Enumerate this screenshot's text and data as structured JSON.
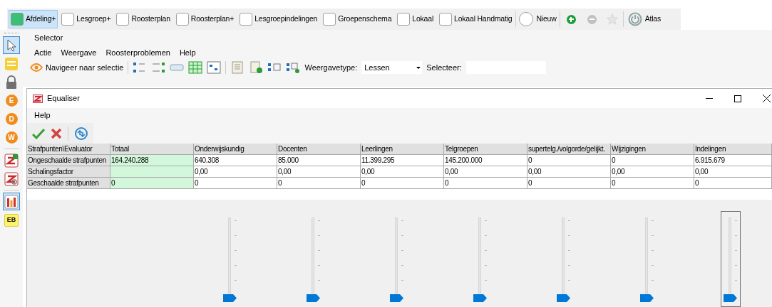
{
  "top_toolbar": [
    {
      "kind": "check",
      "label": "Afdeling+",
      "checked": true
    },
    {
      "kind": "check",
      "label": "Lesgroep+",
      "checked": false
    },
    {
      "kind": "check",
      "label": "Roosterplan",
      "checked": false
    },
    {
      "kind": "check",
      "label": "Roosterplan+",
      "checked": false
    },
    {
      "kind": "check",
      "label": "Lesgroepindelingen",
      "checked": false
    },
    {
      "kind": "check",
      "label": "Groepenschema",
      "checked": false
    },
    {
      "kind": "check",
      "label": "Lokaal",
      "checked": false
    },
    {
      "kind": "check",
      "label": "Lokaal Handmatig",
      "checked": false
    },
    {
      "kind": "radio",
      "label": "Nieuw",
      "checked": false
    },
    {
      "kind": "add",
      "disabled": false
    },
    {
      "kind": "remove",
      "disabled": true
    },
    {
      "kind": "star",
      "disabled": true
    },
    {
      "kind": "power",
      "label": "Atlas",
      "disabled": false
    }
  ],
  "sidebar": [
    {
      "kind": "pointer",
      "selected": true
    },
    {
      "kind": "note",
      "selected": false
    },
    {
      "kind": "lock",
      "selected": false
    },
    {
      "kind": "letter",
      "text": "E",
      "selected": false
    },
    {
      "kind": "letter",
      "text": "D",
      "selected": false
    },
    {
      "kind": "letter",
      "text": "W",
      "selected": false
    },
    {
      "kind": "schedule",
      "selected": false
    },
    {
      "kind": "schedule-search",
      "selected": false
    },
    {
      "kind": "equaliser",
      "selected": true
    },
    {
      "kind": "badge",
      "text": "EB",
      "selected": false
    }
  ],
  "selector": {
    "title": "Selector",
    "menu": [
      "Actie",
      "Weergave",
      "Roosterproblemen",
      "Help"
    ],
    "navigate_button": "Navigeer naar selectie",
    "view_type_label": "Weergavetype:",
    "view_type_value": "Lessen",
    "select_label": "Selecteer:"
  },
  "window": {
    "title": "Equaliser",
    "menu": [
      "Help"
    ],
    "table": {
      "columns": [
        "Strafpunten\\Evaluator",
        "Totaal",
        "Onderwijskundig",
        "Docenten",
        "Leerlingen",
        "Telgroepen",
        "supertelg./volgorde/gelijkt.",
        "Wijzigingen",
        "Indelingen"
      ],
      "rows": [
        {
          "cells": [
            {
              "kind": "header",
              "text": "Ongeschaalde strafpunten"
            },
            {
              "text": "164.240.288",
              "highlighted": true
            },
            {
              "text": "640.308",
              "highlighted": false
            },
            {
              "text": "85.000",
              "highlighted": false
            },
            {
              "text": "11.399.295",
              "highlighted": false
            },
            {
              "text": "145.200.000",
              "highlighted": false
            },
            {
              "text": "0",
              "highlighted": false
            },
            {
              "text": "0",
              "highlighted": false
            },
            {
              "text": "6.915.679",
              "highlighted": false
            }
          ]
        },
        {
          "cells": [
            {
              "kind": "header",
              "text": "Schalingsfactor"
            },
            {
              "text": "",
              "highlighted": true
            },
            {
              "text": "0,00",
              "highlighted": false
            },
            {
              "text": "0,00",
              "highlighted": false
            },
            {
              "text": "0,00",
              "highlighted": false
            },
            {
              "text": "0,00",
              "highlighted": false
            },
            {
              "text": "0,00",
              "highlighted": false
            },
            {
              "text": "0,00",
              "highlighted": false
            },
            {
              "text": "0,00",
              "highlighted": false
            }
          ]
        },
        {
          "cells": [
            {
              "kind": "header",
              "text": "Geschaalde strafpunten"
            },
            {
              "text": "0",
              "highlighted": true
            },
            {
              "text": "0",
              "highlighted": false
            },
            {
              "text": "0",
              "highlighted": false
            },
            {
              "text": "0",
              "highlighted": false
            },
            {
              "text": "0",
              "highlighted": false
            },
            {
              "text": "0",
              "highlighted": false
            },
            {
              "text": "0",
              "highlighted": false
            },
            {
              "text": "0",
              "highlighted": false
            }
          ]
        }
      ]
    },
    "sliders": [
      {
        "level": 0,
        "focused": false
      },
      {
        "level": 0,
        "focused": false
      },
      {
        "level": 0,
        "focused": false
      },
      {
        "level": 0,
        "focused": false
      },
      {
        "level": 0,
        "focused": false
      },
      {
        "level": 0,
        "focused": false
      },
      {
        "level": 0,
        "focused": true
      }
    ]
  }
}
